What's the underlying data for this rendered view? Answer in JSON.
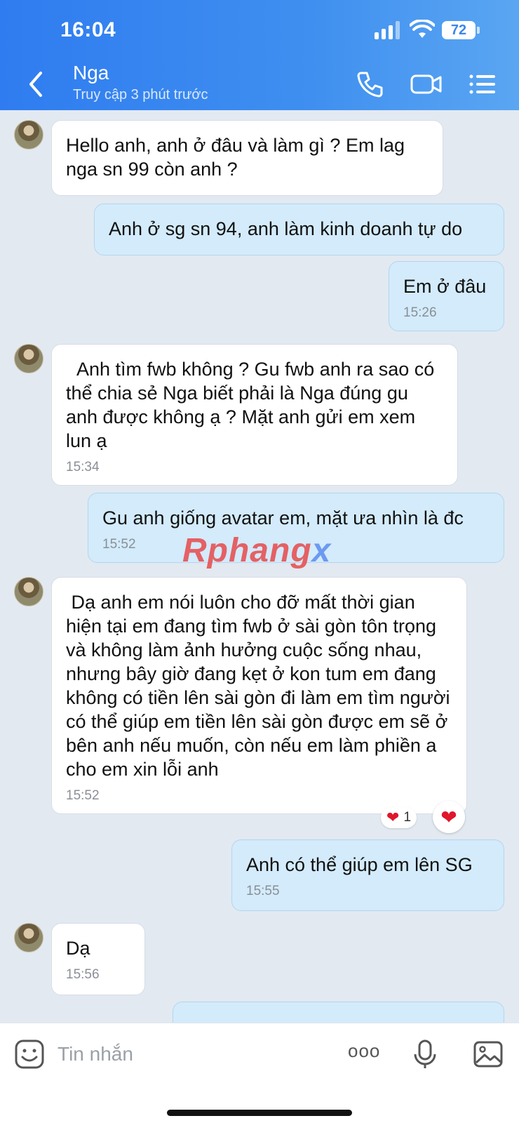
{
  "status_bar": {
    "time": "16:04",
    "battery": "72"
  },
  "header": {
    "name": "Nga",
    "status": "Truy cập 3 phút trước"
  },
  "messages": [
    {
      "dir": "in",
      "text": "Hello anh, anh ở đâu và làm gì ? Em lag nga sn 99 còn anh ?",
      "time": ""
    },
    {
      "dir": "out",
      "text": "Anh ở sg sn 94, anh làm kinh doanh tự do",
      "time": ""
    },
    {
      "dir": "out",
      "text": "Em ở đâu",
      "time": "15:26"
    },
    {
      "dir": "in",
      "text": "  Anh tìm fwb không ? Gu fwb anh ra sao có thể chia sẻ Nga biết phải là Nga đúng gu anh được không ạ ? Mặt anh gửi em xem lun ạ",
      "time": "15:34"
    },
    {
      "dir": "out",
      "text": "Gu anh giống avatar em, mặt ưa nhìn là đc",
      "time": "15:52"
    },
    {
      "dir": "in",
      "text": " Dạ anh em nói luôn cho đỡ mất thời gian hiện tại em đang tìm fwb ở sài gòn tôn trọng và không làm ảnh hưởng cuộc sống nhau, nhưng bây giờ đang kẹt ở kon tum em đang không có tiền lên sài gòn đi làm em tìm người có thể giúp em tiền lên sài gòn được em sẽ ở bên anh nếu muốn, còn nếu em làm phiền a cho em xin lỗi anh",
      "time": "15:52",
      "reaction_count": "1"
    },
    {
      "dir": "out",
      "text": "Anh có thể giúp em lên SG",
      "time": "15:55"
    },
    {
      "dir": "in",
      "text": "Dạ",
      "time": "15:56"
    }
  ],
  "watermark": {
    "part1": "Rphang",
    "part2": "x"
  },
  "input": {
    "placeholder": "Tin nhắn",
    "more": "ooo"
  },
  "icons": [
    "back-icon",
    "phone-icon",
    "video-icon",
    "menu-icon",
    "sticker-icon",
    "more-icon",
    "mic-icon",
    "image-icon"
  ]
}
